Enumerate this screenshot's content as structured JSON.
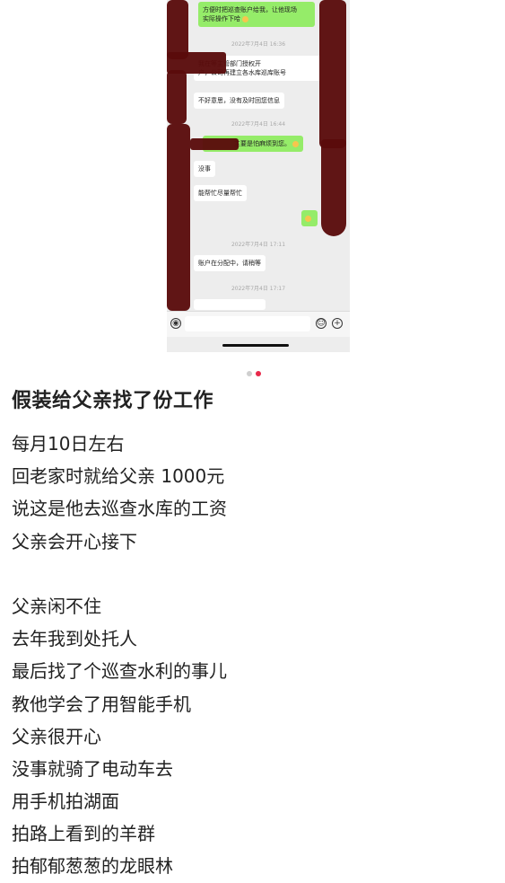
{
  "chat": {
    "msg_top": "方便时把巡查账户给我，让他现场\n实际操作下哈",
    "ts1": "2022年7月4日 16:36",
    "msg_auth": "我在等主管部门授权开\n户，公司再建立各水库巡库账号",
    "msg_sorry": "不好意思，没有及时回您信息",
    "ts2": "2022年7月4日 16:44",
    "msg_trouble": "主要是怕麻烦到您。",
    "msg_fine": "没事",
    "msg_help": "能帮忙尽量帮忙",
    "ts3": "2022年7月4日 17:11",
    "msg_assign": "账户在分配中，请稍等",
    "ts4": "2022年7月4日 17:17"
  },
  "pager": {
    "active_color": "#e8294a",
    "inactive_color": "#cfcfcf"
  },
  "post": {
    "title": "假装给父亲找了份工作",
    "lines": [
      "每月10日左右",
      "回老家时就给父亲 1000元",
      "说这是他去巡查水库的工资",
      "父亲会开心接下",
      "",
      "父亲闲不住",
      "去年我到处托人",
      "最后找了个巡查水利的事儿",
      "教他学会了用智能手机",
      "父亲很开心",
      "没事就骑了电动车去",
      "用手机拍湖面",
      "拍路上看到的羊群",
      "拍郁郁葱葱的龙眼林"
    ]
  }
}
